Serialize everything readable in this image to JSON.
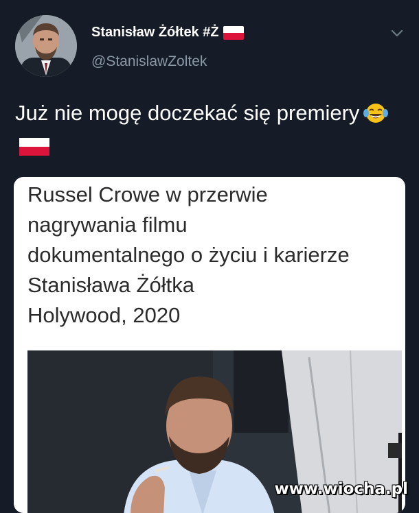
{
  "author": {
    "display_name": "Stanisław Żółtek #Ż",
    "handle": "@StanislawZoltek"
  },
  "tweet": {
    "text": "Już nie mogę doczekać się premiery"
  },
  "card": {
    "lines": [
      "Russel Crowe w przerwie",
      "nagrywania filmu",
      "dokumentalnego o życiu i karierze",
      "Stanisława Żółtka",
      "Holywood, 2020"
    ]
  },
  "watermark": "www.wiocha.pl",
  "icons": {
    "menu": "chevron-down-icon",
    "flag": "poland-flag-icon",
    "emoji": "tears-of-joy-emoji-icon"
  },
  "colors": {
    "background": "#151c27",
    "handle": "#8b98a5",
    "card_background": "#ffffff",
    "flag_white": "#ffffff",
    "flag_red": "#dc143c"
  }
}
